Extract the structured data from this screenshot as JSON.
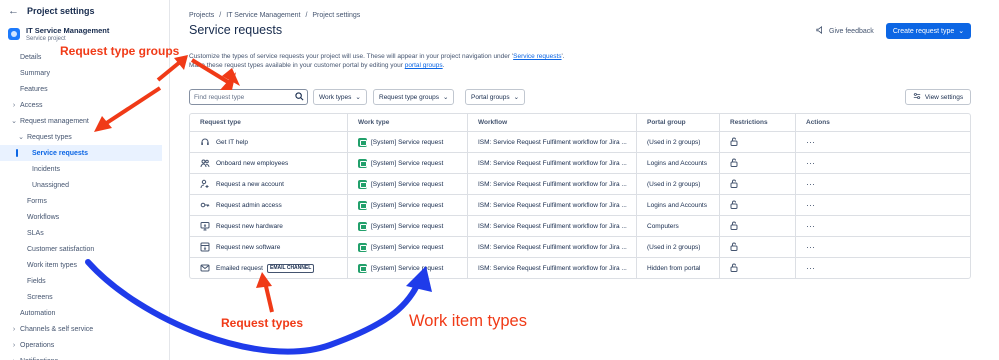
{
  "sidebar": {
    "header": "Project settings",
    "project_name": "IT Service Management",
    "project_type": "Service project",
    "items": [
      {
        "label": "Details",
        "level": 0
      },
      {
        "label": "Summary",
        "level": 0
      },
      {
        "label": "Features",
        "level": 0
      },
      {
        "label": "Access",
        "level": 0,
        "chevron": "›"
      },
      {
        "label": "Request management",
        "level": 0,
        "chevron": "⌄"
      },
      {
        "label": "Request types",
        "level": 1,
        "chevron": "⌄"
      },
      {
        "label": "Service requests",
        "level": 2,
        "selected": true
      },
      {
        "label": "Incidents",
        "level": 2
      },
      {
        "label": "Unassigned",
        "level": 2
      },
      {
        "label": "Forms",
        "level": 1
      },
      {
        "label": "Workflows",
        "level": 1
      },
      {
        "label": "SLAs",
        "level": 1
      },
      {
        "label": "Customer satisfaction",
        "level": 1
      },
      {
        "label": "Work item types",
        "level": 1
      },
      {
        "label": "Fields",
        "level": 1
      },
      {
        "label": "Screens",
        "level": 1
      },
      {
        "label": "Automation",
        "level": 0
      },
      {
        "label": "Channels & self service",
        "level": 0,
        "chevron": "›"
      },
      {
        "label": "Operations",
        "level": 0,
        "chevron": "›"
      },
      {
        "label": "Notifications",
        "level": 0,
        "chevron": "›"
      }
    ]
  },
  "breadcrumb": [
    "Projects",
    "IT Service Management",
    "Project settings"
  ],
  "page_title": "Service requests",
  "description": {
    "line1_prefix": "Customize the types of service requests your project will use. These will appear in your project navigation under '",
    "line1_link": "Service requests",
    "line1_suffix": "'.",
    "line2_prefix": "Make these request types available in your customer portal by editing your ",
    "line2_link": "portal groups",
    "line2_suffix": "."
  },
  "header_actions": {
    "feedback": "Give feedback",
    "create": "Create request type"
  },
  "toolbar": {
    "search_placeholder": "Find request type",
    "filters": [
      "Work types",
      "Request type groups",
      "Portal groups"
    ],
    "view_settings": "View settings"
  },
  "table": {
    "columns": [
      "Request type",
      "Work type",
      "Workflow",
      "Portal group",
      "Restrictions",
      "Actions"
    ],
    "rows": [
      {
        "name": "Get IT help",
        "icon": "headset-icon",
        "work_type": "[System] Service request",
        "workflow": "ISM: Service Request Fulfilment workflow for Jira ...",
        "portal_group": "(Used in 2 groups)"
      },
      {
        "name": "Onboard new employees",
        "icon": "people-icon",
        "work_type": "[System] Service request",
        "workflow": "ISM: Service Request Fulfilment workflow for Jira ...",
        "portal_group": "Logins and Accounts"
      },
      {
        "name": "Request a new account",
        "icon": "person-add-icon",
        "work_type": "[System] Service request",
        "workflow": "ISM: Service Request Fulfilment workflow for Jira ...",
        "portal_group": "(Used in 2 groups)"
      },
      {
        "name": "Request admin access",
        "icon": "key-icon",
        "work_type": "[System] Service request",
        "workflow": "ISM: Service Request Fulfilment workflow for Jira ...",
        "portal_group": "Logins and Accounts"
      },
      {
        "name": "Request new hardware",
        "icon": "monitor-icon",
        "work_type": "[System] Service request",
        "workflow": "ISM: Service Request Fulfilment workflow for Jira ...",
        "portal_group": "Computers"
      },
      {
        "name": "Request new software",
        "icon": "download-box-icon",
        "work_type": "[System] Service request",
        "workflow": "ISM: Service Request Fulfilment workflow for Jira ...",
        "portal_group": "(Used in 2 groups)"
      },
      {
        "name": "Emailed request",
        "icon": "envelope-icon",
        "badge": "EMAIL CHANNEL",
        "work_type": "[System] Service request",
        "workflow": "ISM: Service Request Fulfilment workflow for Jira ...",
        "portal_group": "Hidden from portal"
      }
    ]
  },
  "annotations": {
    "request_type_groups": "Request type groups",
    "request_types": "Request types",
    "work_item_types": "Work item types"
  },
  "colors": {
    "accent": "#0c66e4",
    "work_type_icon": "#22a06b",
    "annotation_red": "#f03a17",
    "annotation_blue": "#1f3bea"
  }
}
